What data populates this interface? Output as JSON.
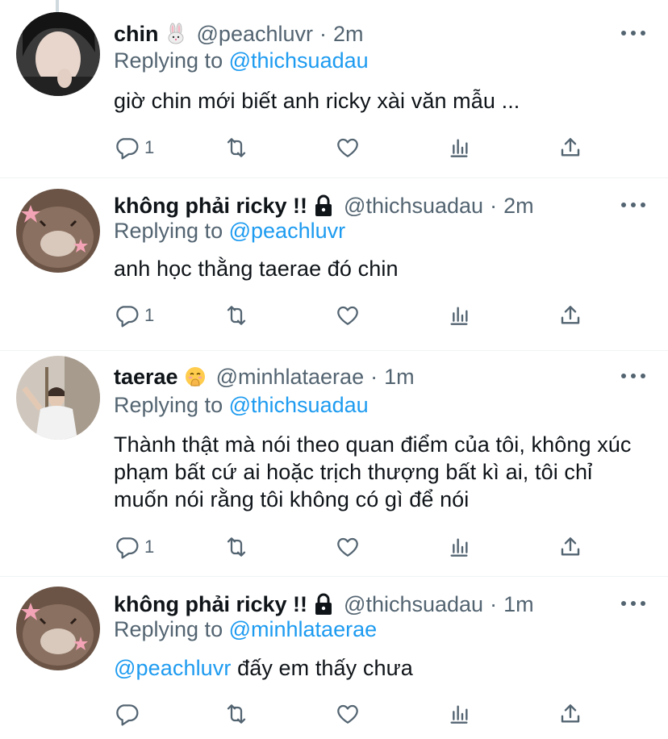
{
  "tweets": [
    {
      "name": "chin",
      "emoji": "rabbit-emoji",
      "handle": "@peachluvr",
      "dot": "·",
      "time": "2m",
      "replying_prefix": "Replying to",
      "replying_to": "@thichsuadau",
      "text": "giờ chin mới biết anh ricky xài văn mẫu ...",
      "reply_count": "1"
    },
    {
      "name": "không phải ricky !!",
      "emoji": "lock-icon",
      "handle": "@thichsuadau",
      "dot": "·",
      "time": "2m",
      "replying_prefix": "Replying to",
      "replying_to": "@peachluvr",
      "text": "anh học thằng taerae đó chin",
      "reply_count": "1"
    },
    {
      "name": "taerae",
      "emoji": "hand-over-mouth-emoji",
      "handle": "@minhlataerae",
      "dot": "·",
      "time": "1m",
      "replying_prefix": "Replying to",
      "replying_to": "@thichsuadau",
      "text": "Thành thật mà nói theo quan điểm của tôi, không xúc phạm bất cứ ai hoặc trịch thượng bất kì ai, tôi chỉ muốn nói rằng tôi không có gì để nói",
      "reply_count": "1"
    },
    {
      "name": "không phải ricky !!",
      "emoji": "lock-icon",
      "handle": "@thichsuadau",
      "dot": "·",
      "time": "1m",
      "replying_prefix": "Replying to",
      "replying_to": "@minhlataerae",
      "text_mention": "@peachluvr",
      "text": " đấy em thấy chưa",
      "reply_count": ""
    }
  ],
  "colors": {
    "text": "#0f1419",
    "secondary": "#536471",
    "link": "#1d9bf0",
    "divider": "#eff3f4"
  }
}
